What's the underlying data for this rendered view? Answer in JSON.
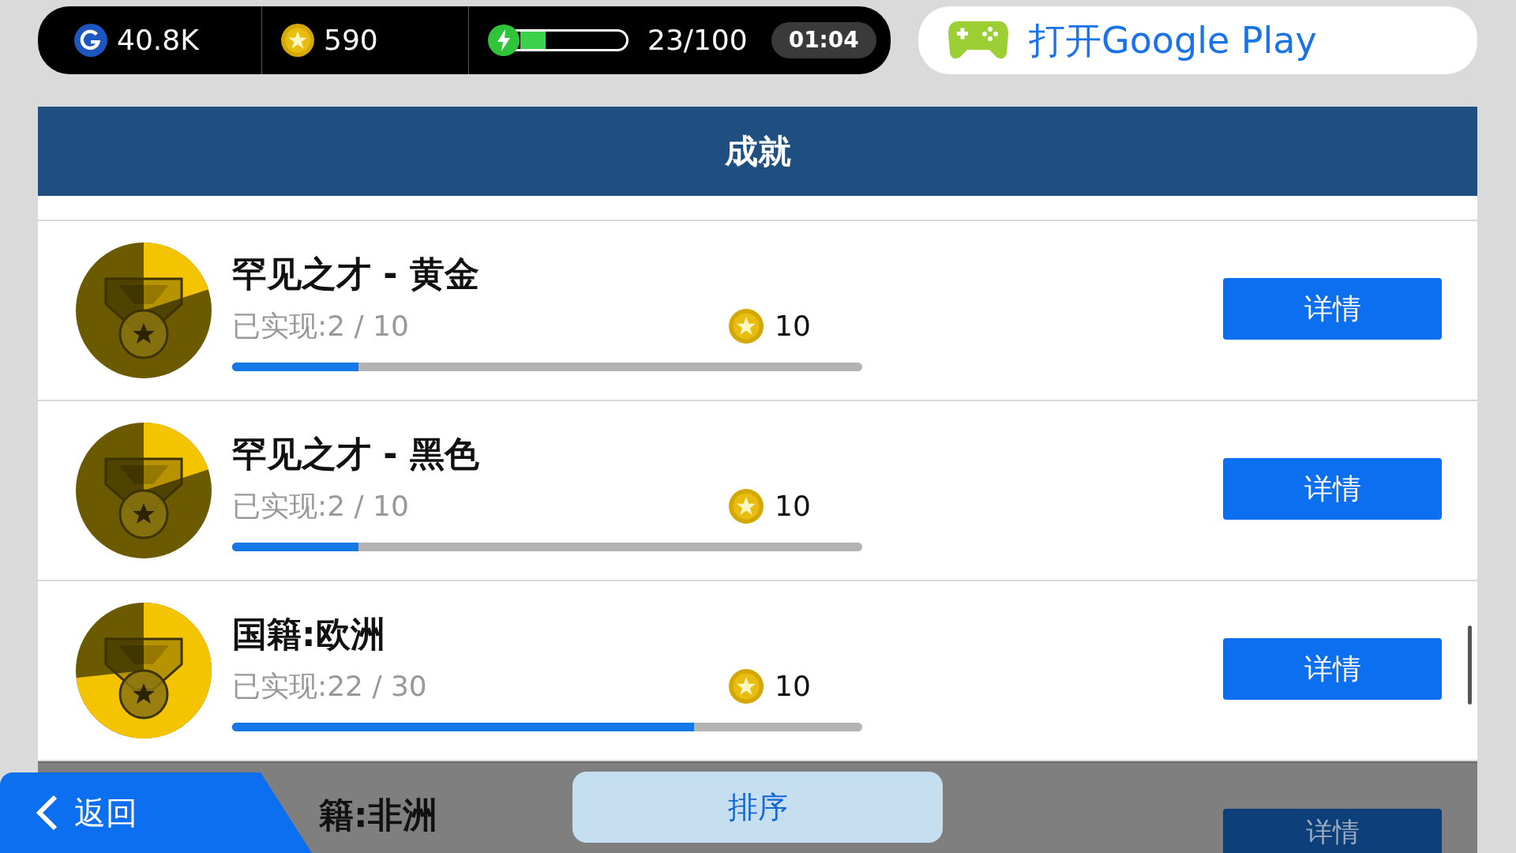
{
  "currency_bar": {
    "gems": "40.8K",
    "coins": "590",
    "energy": {
      "level": 0.23,
      "reading": "23/100",
      "timer": "01:04"
    }
  },
  "google_play_button": "打开Google Play",
  "header": {
    "title": "成就"
  },
  "achievements": [
    {
      "title": "罕见之才 - 黄金",
      "progress": "已实现:2 / 10",
      "level": 0.2,
      "reward": "10",
      "button": "详情"
    },
    {
      "title": "罕见之才 - 黑色",
      "progress": "已实现:2 / 10",
      "level": 0.2,
      "reward": "10",
      "button": "详情"
    },
    {
      "title": "国籍:欧洲",
      "progress": "已实现:22 / 30",
      "level": 0.733,
      "reward": "10",
      "button": "详情"
    },
    {
      "kind": "dimmed",
      "title": "籍:非洲",
      "button": "详情"
    }
  ],
  "footer": {
    "back": "返回",
    "sort": "排序"
  }
}
